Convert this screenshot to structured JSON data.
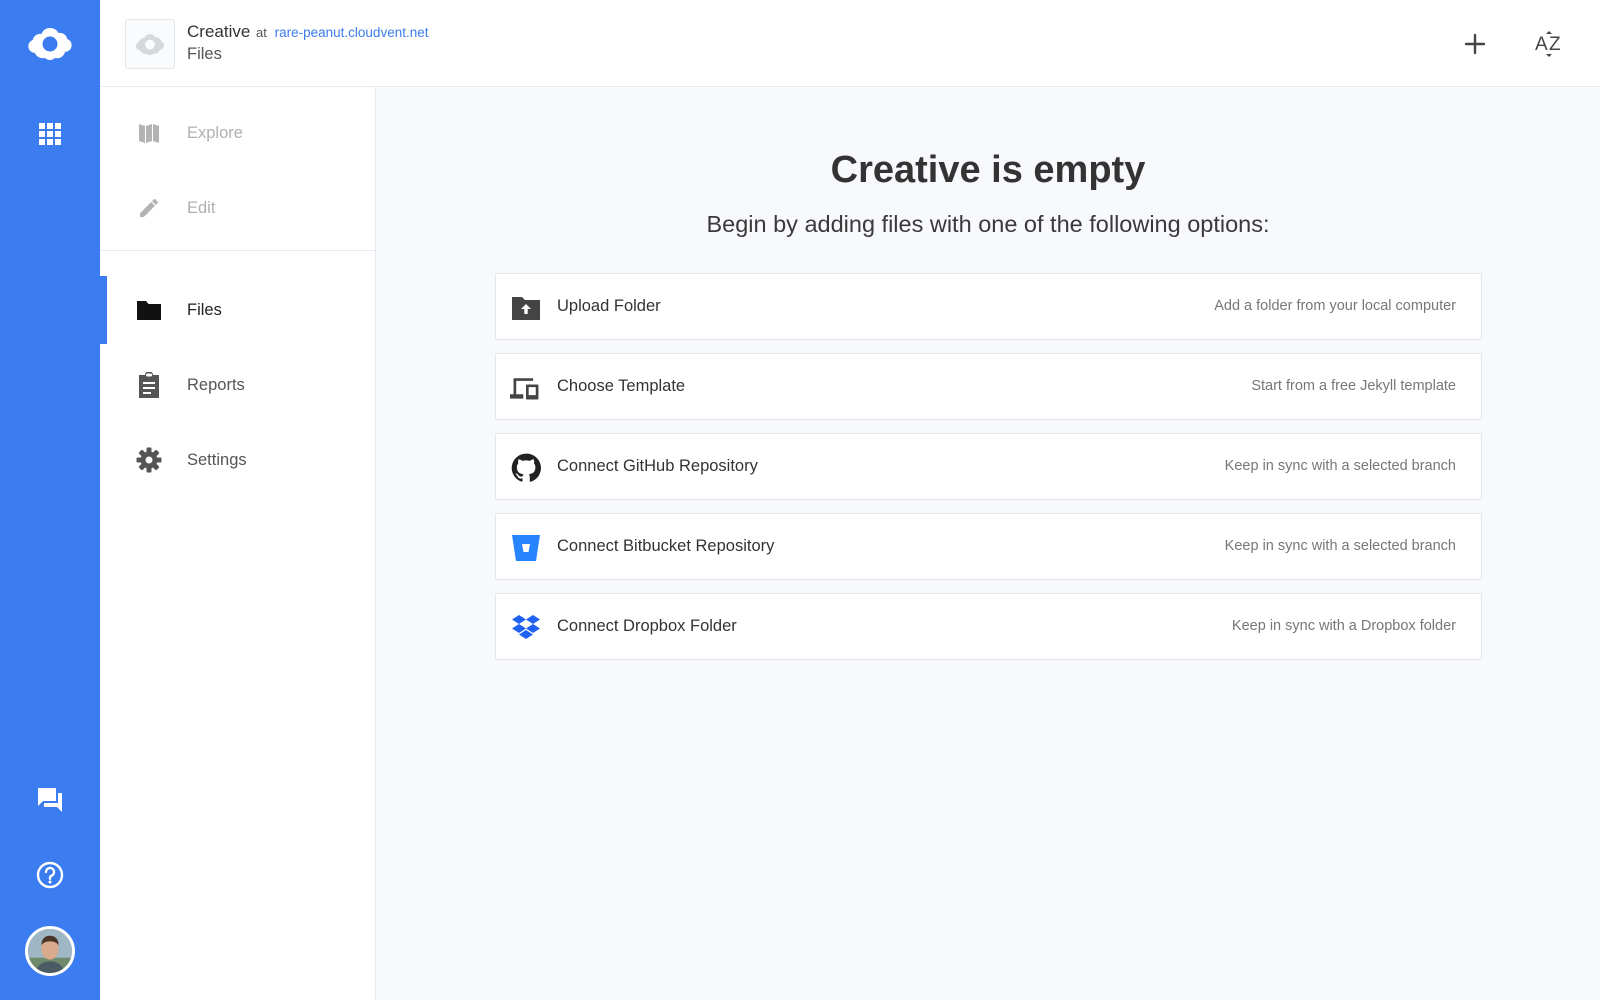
{
  "colors": {
    "rail": "#3b7cf0",
    "accent": "#3b7cf0",
    "bitbucket": "#2684ff",
    "dropbox": "#1f62f2"
  },
  "rail": {
    "logo_icon": "cloudcannon-logo-icon",
    "apps_icon": "apps-grid-icon",
    "chat_icon": "chat-icon",
    "help_icon": "help-circle-icon",
    "avatar_icon": "user-avatar"
  },
  "header": {
    "site_name": "Creative",
    "at": "at",
    "site_url": "rare-peanut.cloudvent.net",
    "section": "Files",
    "add_icon": "plus-icon",
    "sort_icon": "sort-az-icon"
  },
  "nav": {
    "items": [
      {
        "label": "Explore",
        "icon": "map-icon",
        "state": "disabled"
      },
      {
        "label": "Edit",
        "icon": "pencil-icon",
        "state": "disabled"
      },
      {
        "label": "Files",
        "icon": "folder-icon",
        "state": "active"
      },
      {
        "label": "Reports",
        "icon": "clipboard-icon",
        "state": "normal"
      },
      {
        "label": "Settings",
        "icon": "gear-icon",
        "state": "normal"
      }
    ]
  },
  "main": {
    "title": "Creative is empty",
    "subtitle": "Begin by adding files with one of the following options:",
    "options": [
      {
        "label": "Upload Folder",
        "desc": "Add a folder from your local computer",
        "icon": "folder-upload-icon"
      },
      {
        "label": "Choose Template",
        "desc": "Start from a free Jekyll template",
        "icon": "devices-icon"
      },
      {
        "label": "Connect GitHub Repository",
        "desc": "Keep in sync with a selected branch",
        "icon": "github-icon"
      },
      {
        "label": "Connect Bitbucket Repository",
        "desc": "Keep in sync with a selected branch",
        "icon": "bitbucket-icon"
      },
      {
        "label": "Connect Dropbox Folder",
        "desc": "Keep in sync with a Dropbox folder",
        "icon": "dropbox-icon"
      }
    ]
  }
}
